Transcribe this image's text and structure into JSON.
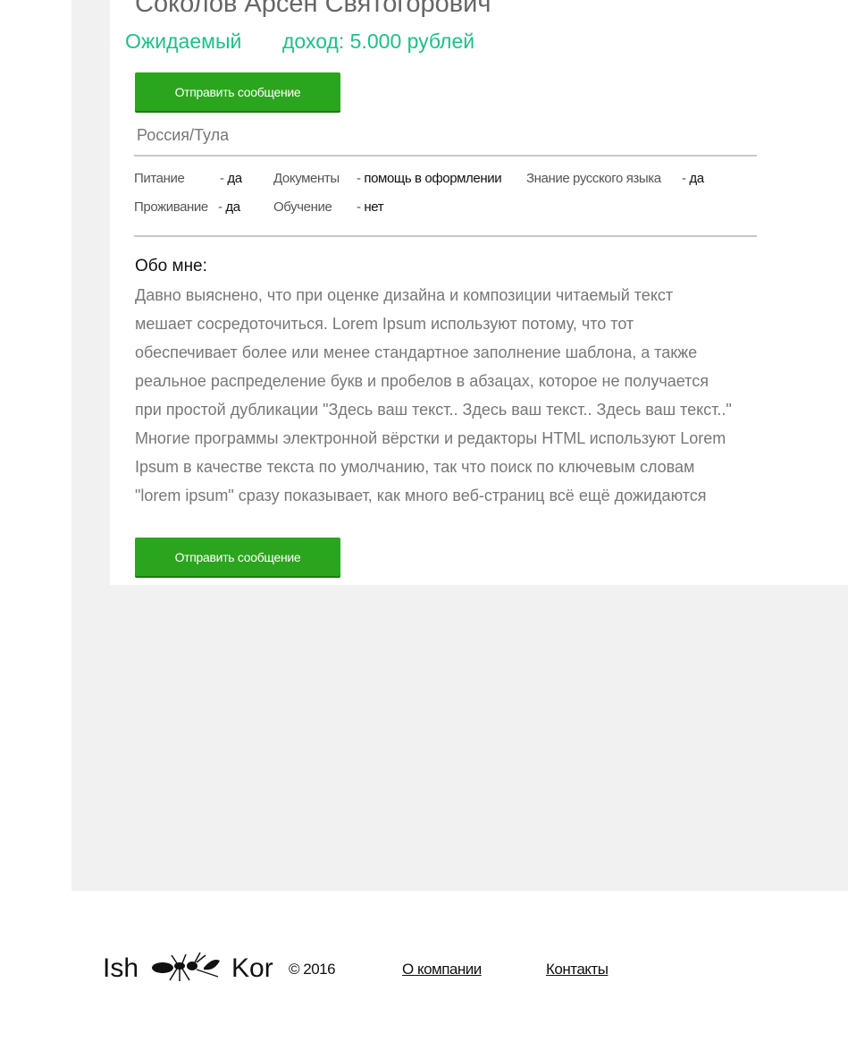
{
  "profile": {
    "name": "Соколов Арсен Святогорович",
    "income_label": "Ожидаемый",
    "income_value": "доход: 5.000 рублей",
    "location": "Россия/Тула",
    "send_button_label": "Отправить сообщение"
  },
  "details": {
    "food_label": "Питание",
    "food_value": "да",
    "housing_label": "Проживание",
    "housing_value": "да",
    "documents_label": "Документы",
    "documents_value": "помощь в оформлении",
    "training_label": "Обучение",
    "training_value": "нет",
    "russian_label": "Знание русского языка",
    "russian_value": "да",
    "dash": "-"
  },
  "about": {
    "title": "Обо мне:",
    "lines": [
      "Давно выяснено, что при оценке дизайна и композиции читаемый текст",
      "мешает сосредоточиться. Lorem Ipsum используют потому, что тот",
      "обеспечивает более или менее стандартное заполнение шаблона, а также",
      "реальное распределение букв и пробелов в абзацах, которое не получается",
      "при простой дубликации \"Здесь ваш текст.. Здесь ваш текст.. Здесь ваш текст..\"",
      "Многие программы электронной вёрстки и редакторы HTML используют Lorem",
      "Ipsum в качестве текста по умолчанию, так что поиск по ключевым словам",
      "\"lorem ipsum\" сразу показывает, как много веб-страниц всё ещё дожидаются"
    ]
  },
  "footer": {
    "logo_left": "Ish",
    "logo_right": "Kor",
    "logo_icon": "ant-icon",
    "copyright": "© 2016",
    "link_about": "О компании",
    "link_contacts": "Контакты"
  },
  "colors": {
    "accent_green": "#2ba51e",
    "income_teal": "#1cc08a",
    "background_gray": "#f1f1f1"
  }
}
